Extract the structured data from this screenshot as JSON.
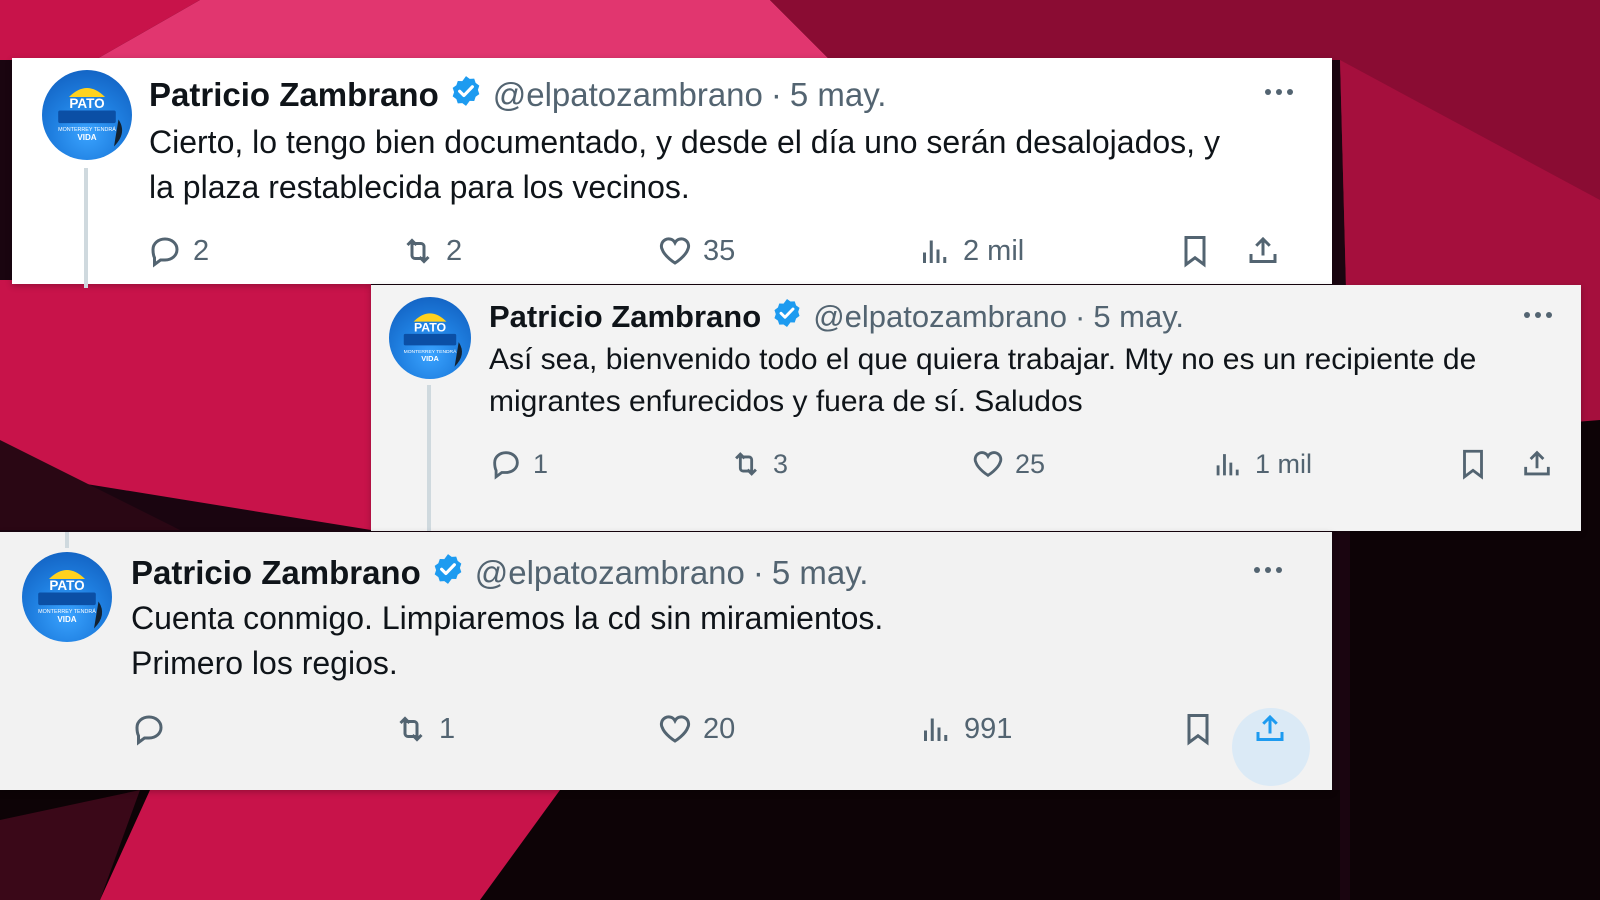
{
  "colors": {
    "background": "#1a0510",
    "magenta": "#c8134a",
    "pink": "#e1366f",
    "dark_red": "#7a0a2c",
    "verified_blue": "#1d9bf0",
    "text": "#0f1419",
    "muted": "#536471",
    "share_hover": "#dbeaf6"
  },
  "avatar_text": {
    "brand": "PATO",
    "line1": "MONTERREY TENDRÁ",
    "line2": "VIDA"
  },
  "tweets": [
    {
      "name": "Patricio Zambrano",
      "handle": "@elpatozambrano",
      "separator": "·",
      "date": "5 may.",
      "lines": [
        "Cierto, lo tengo bien documentado, y desde el día uno serán desalojados, y",
        "la plaza restablecida para los vecinos."
      ],
      "replies": "2",
      "retweets": "2",
      "likes": "35",
      "views": "2 mil"
    },
    {
      "name": "Patricio Zambrano",
      "handle": "@elpatozambrano",
      "separator": "·",
      "date": "5 may.",
      "lines": [
        "Así sea, bienvenido todo el que quiera trabajar. Mty no es un recipiente de",
        "migrantes enfurecidos y fuera de sí. Saludos"
      ],
      "replies": "1",
      "retweets": "3",
      "likes": "25",
      "views": "1 mil"
    },
    {
      "name": "Patricio Zambrano",
      "handle": "@elpatozambrano",
      "separator": "·",
      "date": "5 may.",
      "lines": [
        "Cuenta conmigo. Limpiaremos la cd sin miramientos.",
        "Primero los regios."
      ],
      "replies": "",
      "retweets": "1",
      "likes": "20",
      "views": "991"
    }
  ]
}
